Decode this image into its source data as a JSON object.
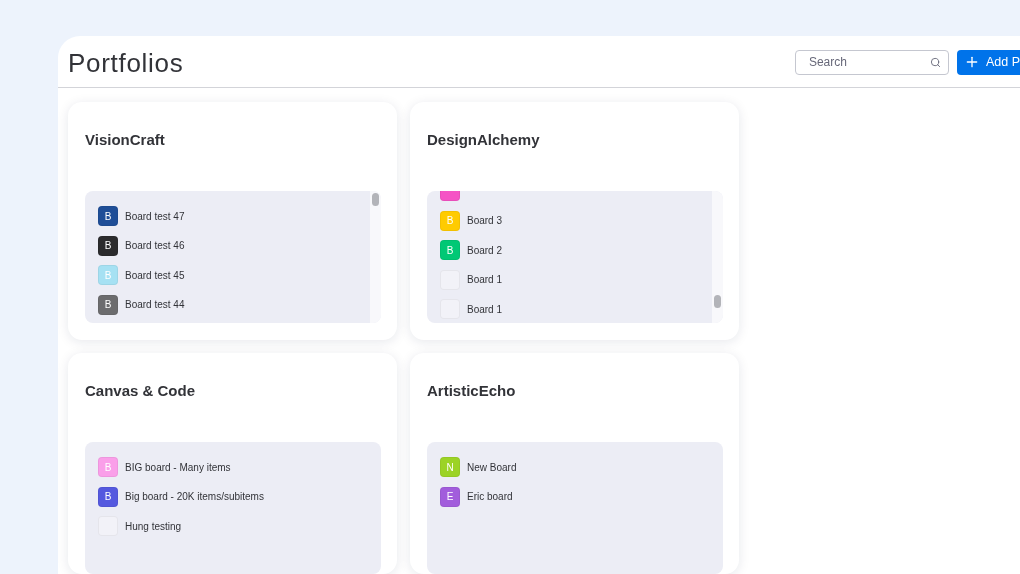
{
  "page": {
    "title": "Portfolios"
  },
  "search": {
    "placeholder": "Search"
  },
  "add_button": {
    "label": "Add P"
  },
  "portfolios": [
    {
      "name": "VisionCraft",
      "scrollbar": true,
      "scrolled_to_end": false,
      "boards": [
        {
          "initial": "B",
          "name": "Board test 47",
          "color": "#1f4e97"
        },
        {
          "initial": "B",
          "name": "Board test 46",
          "color": "#2b2b2d"
        },
        {
          "initial": "B",
          "name": "Board test 45",
          "color": "#a6e1f3"
        },
        {
          "initial": "B",
          "name": "Board test 44",
          "color": "#6c6c6e"
        }
      ]
    },
    {
      "name": "DesignAlchemy",
      "scrollbar": true,
      "scrolled_to_end": true,
      "boards": [
        {
          "color": "#f553c5"
        },
        {
          "initial": "B",
          "name": "Board 3",
          "color": "#ffcb00"
        },
        {
          "initial": "B",
          "name": "Board 2",
          "color": "#00c875"
        },
        {
          "name": "Board 1",
          "color": "#f2f2f8"
        },
        {
          "name": "Board 1",
          "color": "#f2f2f8"
        }
      ]
    },
    {
      "name": "Canvas & Code",
      "scrollbar": false,
      "scrolled_to_end": false,
      "boards": [
        {
          "initial": "B",
          "name": "BIG board - Many items",
          "color": "#fa9fe9"
        },
        {
          "initial": "B",
          "name": "Big board - 20K items/subitems",
          "color": "#5559df"
        },
        {
          "name": "Hung testing",
          "color": "#f2f2f8"
        }
      ]
    },
    {
      "name": "ArtisticEcho",
      "scrollbar": false,
      "scrolled_to_end": false,
      "boards": [
        {
          "initial": "N",
          "name": "New Board",
          "color": "#9cd326"
        },
        {
          "initial": "E",
          "name": "Eric board",
          "color": "#a25ddc"
        }
      ]
    }
  ]
}
